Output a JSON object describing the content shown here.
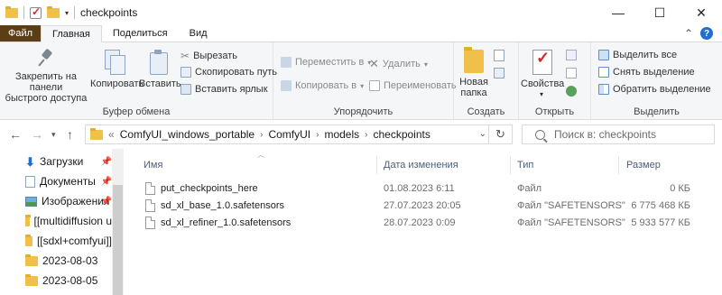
{
  "window": {
    "title": "checkpoints",
    "minimize": "—",
    "maximize": "☐",
    "close": "✕"
  },
  "ribbon_tabs": {
    "file": "Файл",
    "home": "Главная",
    "share": "Поделиться",
    "view": "Вид",
    "collapse": "⌃",
    "help": "?"
  },
  "ribbon": {
    "clipboard": {
      "label": "Буфер обмена",
      "pin_line1": "Закрепить на панели",
      "pin_line2": "быстрого доступа",
      "copy": "Копировать",
      "paste": "Вставить",
      "cut": "Вырезать",
      "copy_path": "Скопировать путь",
      "paste_shortcut": "Вставить ярлык"
    },
    "organize": {
      "label": "Упорядочить",
      "move_to": "Переместить в",
      "copy_to": "Копировать в",
      "delete": "Удалить",
      "rename": "Переименовать"
    },
    "create": {
      "label": "Создать",
      "new_folder_line1": "Новая",
      "new_folder_line2": "папка"
    },
    "open": {
      "label": "Открыть",
      "properties": "Свойства"
    },
    "select": {
      "label": "Выделить",
      "select_all": "Выделить все",
      "select_none": "Снять выделение",
      "invert": "Обратить выделение"
    }
  },
  "address": {
    "prefix": "«",
    "crumbs": [
      "ComfyUI_windows_portable",
      "ComfyUI",
      "models",
      "checkpoints"
    ],
    "search_placeholder": "Поиск в: checkpoints"
  },
  "nav_pane": {
    "items": [
      {
        "label": "Загрузки",
        "icon": "download-icon",
        "pinned": true
      },
      {
        "label": "Документы",
        "icon": "document-icon",
        "pinned": true
      },
      {
        "label": "Изображения",
        "icon": "image-icon",
        "pinned": true
      },
      {
        "label": "[[multidiffusion u",
        "icon": "folder-icon",
        "pinned": false
      },
      {
        "label": "[[sdxl+comfyui]]",
        "icon": "folder-icon",
        "pinned": false
      },
      {
        "label": "2023-08-03",
        "icon": "folder-icon",
        "pinned": false
      },
      {
        "label": "2023-08-05",
        "icon": "folder-icon",
        "pinned": false
      }
    ]
  },
  "file_list": {
    "columns": {
      "name": "Имя",
      "modified": "Дата изменения",
      "type": "Тип",
      "size": "Размер"
    },
    "rows": [
      {
        "name": "put_checkpoints_here",
        "modified": "01.08.2023 6:11",
        "type": "Файл",
        "size": "0 КБ"
      },
      {
        "name": "sd_xl_base_1.0.safetensors",
        "modified": "27.07.2023 20:05",
        "type": "Файл \"SAFETENSORS\"",
        "size": "6 775 468 КБ"
      },
      {
        "name": "sd_xl_refiner_1.0.safetensors",
        "modified": "28.07.2023 0:09",
        "type": "Файл \"SAFETENSORS\"",
        "size": "5 933 577 КБ"
      }
    ]
  }
}
